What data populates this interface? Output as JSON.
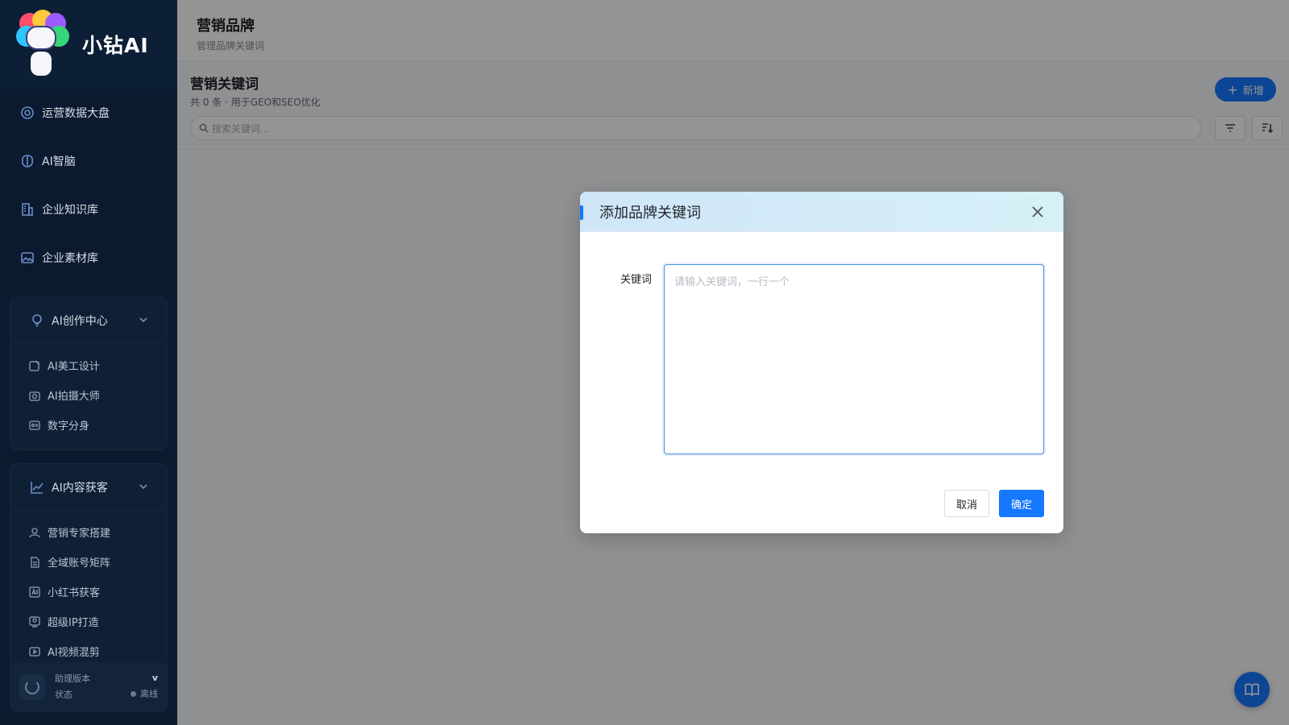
{
  "app": {
    "brand_name": "小钻AI"
  },
  "sidebar": {
    "items": [
      {
        "label": "运营数据大盘",
        "icon": "dashboard-icon"
      },
      {
        "label": "AI智脑",
        "icon": "brain-icon"
      },
      {
        "label": "企业知识库",
        "icon": "building-icon"
      },
      {
        "label": "企业素材库",
        "icon": "image-icon"
      }
    ],
    "groups": [
      {
        "label": "AI创作中心",
        "icon": "bulb-icon",
        "items": [
          {
            "label": "AI美工设计",
            "icon": "edit-icon"
          },
          {
            "label": "AI拍摄大师",
            "icon": "camera-icon"
          },
          {
            "label": "数字分身",
            "icon": "id-card-icon"
          }
        ]
      },
      {
        "label": "AI内容获客",
        "icon": "trend-icon",
        "items": [
          {
            "label": "营销专家搭建",
            "icon": "user-icon"
          },
          {
            "label": "全域账号矩阵",
            "icon": "document-icon"
          },
          {
            "label": "小红书获客",
            "icon": "ai-tag-icon"
          },
          {
            "label": "超级IP打造",
            "icon": "badge-icon"
          },
          {
            "label": "AI视频混剪",
            "icon": "video-icon"
          }
        ]
      }
    ],
    "status": {
      "version_label": "助理版本",
      "version_value": "v",
      "state_label": "状态",
      "state_value": "离线"
    }
  },
  "header": {
    "title": "营销品牌",
    "subtitle": "管理品牌关键词"
  },
  "section": {
    "title": "营销关键词",
    "subtitle": "共 0 条 · 用于GEO和SEO优化",
    "add_label": "新增",
    "search_placeholder": "搜索关键词..."
  },
  "modal": {
    "title": "添加品牌关键词",
    "field_label": "关键词",
    "textarea_placeholder": "请输入关键词，一行一个",
    "cancel_label": "取消",
    "confirm_label": "确定"
  },
  "colors": {
    "primary": "#1677ff",
    "sidebar_bg": "#0b1a2e"
  }
}
